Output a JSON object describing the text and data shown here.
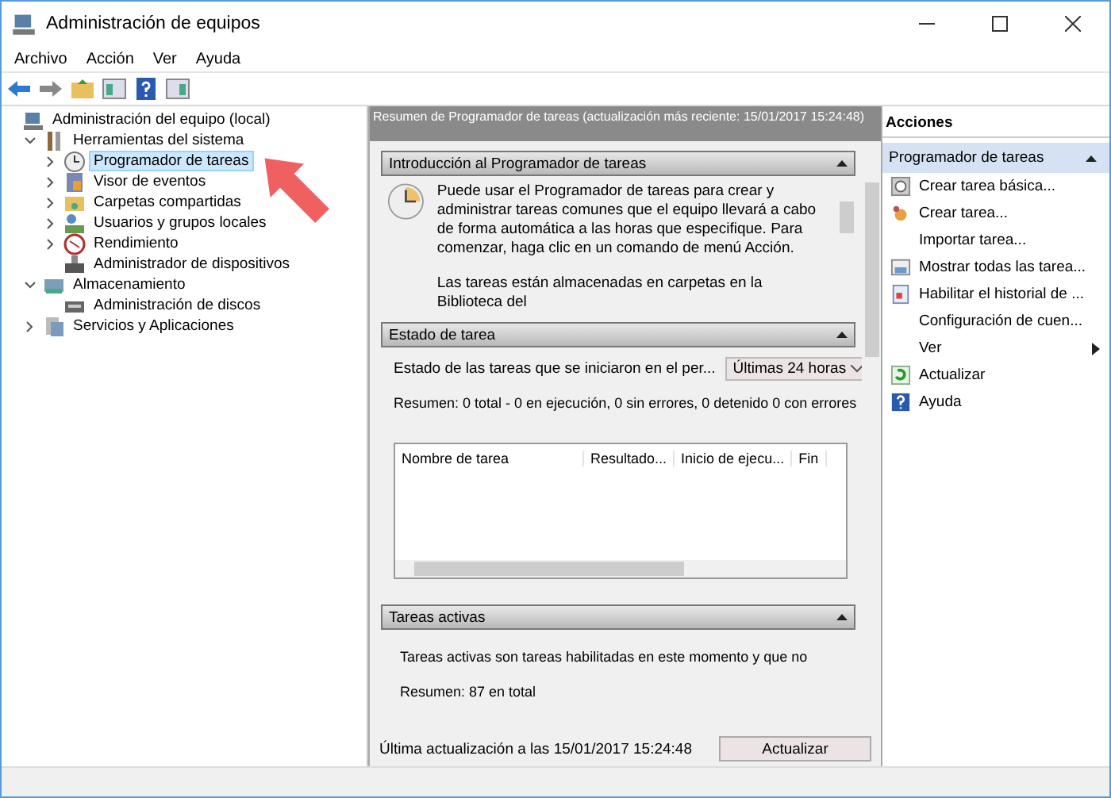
{
  "window": {
    "title": "Administración de equipos"
  },
  "menu": [
    "Archivo",
    "Acción",
    "Ver",
    "Ayuda"
  ],
  "tree": [
    {
      "label": "Administración del equipo (local)",
      "kind": "computer",
      "expandable": false,
      "selected": false,
      "children": [
        {
          "label": "Herramientas del sistema",
          "kind": "tools",
          "expandable": true,
          "expanded": true,
          "selected": false,
          "children": [
            {
              "label": "Programador de tareas",
              "kind": "clock",
              "expandable": true,
              "expanded": false,
              "selected": true
            },
            {
              "label": "Visor de eventos",
              "kind": "event",
              "expandable": true,
              "expanded": false,
              "selected": false
            },
            {
              "label": "Carpetas compartidas",
              "kind": "folder",
              "expandable": true,
              "expanded": false,
              "selected": false
            },
            {
              "label": "Usuarios y grupos locales",
              "kind": "users",
              "expandable": true,
              "expanded": false,
              "selected": false
            },
            {
              "label": "Rendimiento",
              "kind": "perf",
              "expandable": true,
              "expanded": false,
              "selected": false
            },
            {
              "label": "Administrador de dispositivos",
              "kind": "device",
              "expandable": false,
              "selected": false
            }
          ]
        },
        {
          "label": "Almacenamiento",
          "kind": "storage",
          "expandable": true,
          "expanded": true,
          "selected": false,
          "children": [
            {
              "label": "Administración de discos",
              "kind": "disk",
              "expandable": false,
              "selected": false
            }
          ]
        },
        {
          "label": "Servicios y Aplicaciones",
          "kind": "services",
          "expandable": true,
          "expanded": false,
          "selected": false
        }
      ]
    }
  ],
  "center": {
    "header": "Resumen de Programador de tareas (actualización más reciente: 15/01/2017 15:24:48)",
    "intro": {
      "title": "Introducción al Programador de tareas",
      "paragraphs": [
        "Puede usar el Programador de tareas para crear y administrar tareas comunes que el equipo llevará a cabo de forma automática a las horas que especifique. Para comenzar, haga clic en un comando de menú Acción.",
        "Las tareas están almacenadas en carpetas en la Biblioteca del"
      ]
    },
    "status": {
      "title": "Estado de tarea",
      "period_label": "Estado de las tareas que se iniciaron en el per...",
      "period_value": "Últimas 24 horas",
      "summary": "Resumen: 0 total - 0 en ejecución, 0 sin errores, 0 detenido  0 con errores",
      "columns": [
        "Nombre de tarea",
        "Resultado...",
        "Inicio de ejecu...",
        "Fin"
      ]
    },
    "active": {
      "title": "Tareas activas",
      "text": "Tareas activas son tareas habilitadas en este momento y que no",
      "summary": "Resumen: 87 en total"
    },
    "last_update": "Última actualización a las 15/01/2017 15:24:48",
    "refresh_button": "Actualizar"
  },
  "actions": {
    "title": "Acciones",
    "group": "Programador de tareas",
    "items": [
      {
        "label": "Crear tarea básica...",
        "kind": "wizard"
      },
      {
        "label": "Crear tarea...",
        "kind": "create"
      },
      {
        "label": "Importar tarea...",
        "kind": "plain"
      },
      {
        "label": "Mostrar todas las tarea...",
        "kind": "list"
      },
      {
        "label": "Habilitar el historial de ...",
        "kind": "history"
      },
      {
        "label": "Configuración de cuen...",
        "kind": "plain"
      },
      {
        "label": "Ver",
        "kind": "submenu"
      },
      {
        "label": "Actualizar",
        "kind": "refresh"
      },
      {
        "label": "Ayuda",
        "kind": "help"
      }
    ]
  }
}
